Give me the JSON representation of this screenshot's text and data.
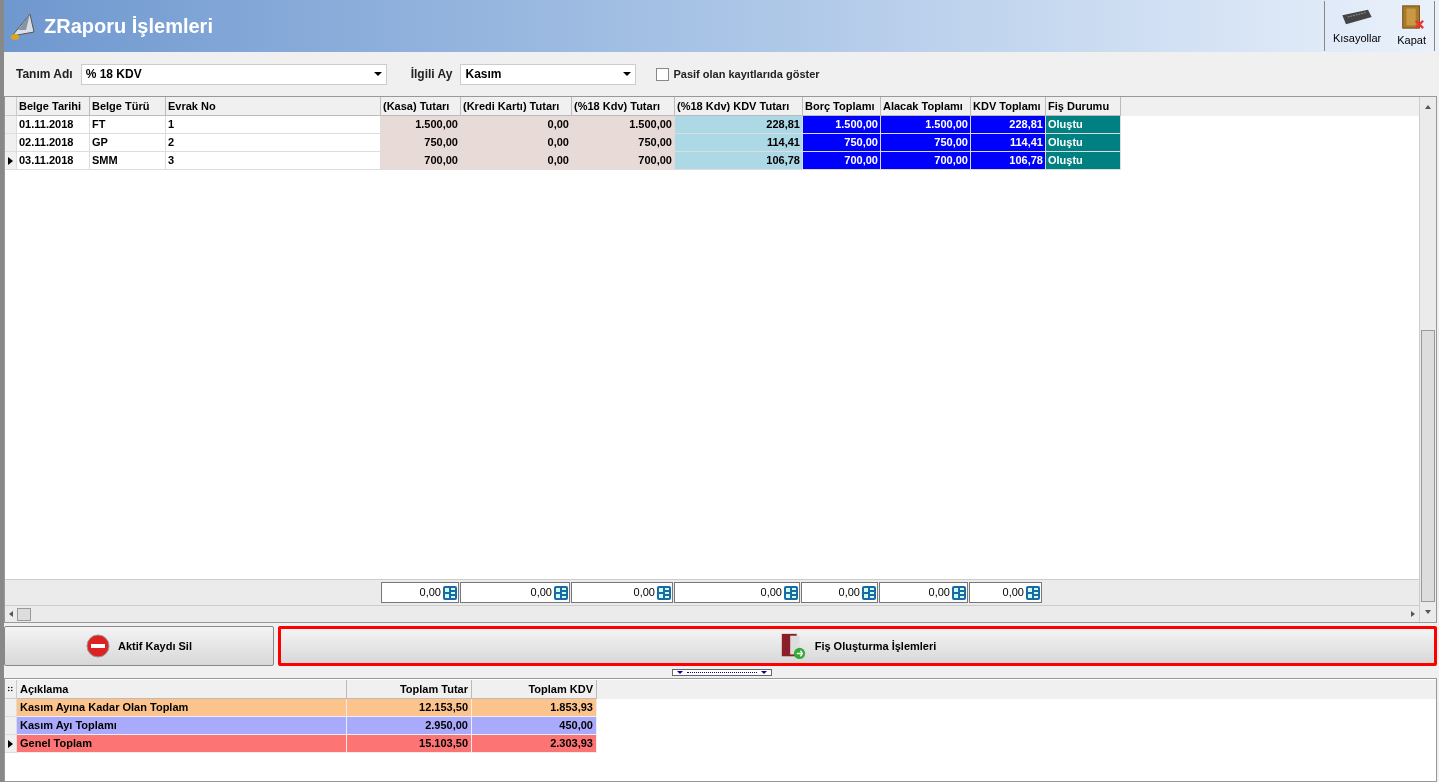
{
  "window": {
    "title": "ZRaporu İşlemleri"
  },
  "toolbar": [
    {
      "label": "Kısayollar",
      "kind": "keyboard"
    },
    {
      "label": "Kapat",
      "kind": "close"
    }
  ],
  "filters": {
    "tanim_label": "Tanım Adı",
    "tanim_value": "% 18 KDV",
    "ay_label": "İlgili Ay",
    "ay_value": "Kasım",
    "pasif": {
      "label": "Pasif olan kayıtlarıda göster",
      "checked": false
    }
  },
  "table": {
    "columns": [
      {
        "label": "Belge Tarihi",
        "color": "#ffffff"
      },
      {
        "label": "Belge Türü",
        "color": "#ffffff"
      },
      {
        "label": "Evrak No",
        "color": "#ffffff"
      },
      {
        "label": "(Kasa) Tutarı",
        "color": "#e8dad6"
      },
      {
        "label": "(Kredi Kartı) Tutarı",
        "color": "#e8dad6"
      },
      {
        "label": "(%18 Kdv) Tutarı",
        "color": "#e8dad6"
      },
      {
        "label": "(%18 Kdv) KDV Tutarı",
        "color": "#add8e6"
      },
      {
        "label": "Borç Toplamı",
        "color": "#0000ff"
      },
      {
        "label": "Alacak Toplamı",
        "color": "#0000ff"
      },
      {
        "label": "KDV Toplamı",
        "color": "#0000ff"
      },
      {
        "label": "Fiş Durumu",
        "color": "#008080"
      }
    ],
    "rows": [
      {
        "selected": false,
        "cells": [
          "01.11.2018",
          "FT",
          "1",
          "1.500,00",
          "0,00",
          "1.500,00",
          "228,81",
          "1.500,00",
          "1.500,00",
          "228,81",
          "Oluştu"
        ]
      },
      {
        "selected": false,
        "cells": [
          "02.11.2018",
          "GP",
          "2",
          "750,00",
          "0,00",
          "750,00",
          "114,41",
          "750,00",
          "750,00",
          "114,41",
          "Oluştu"
        ]
      },
      {
        "selected": true,
        "cells": [
          "03.11.2018",
          "SMM",
          "3",
          "700,00",
          "0,00",
          "700,00",
          "106,78",
          "700,00",
          "700,00",
          "106,78",
          "Oluştu"
        ]
      }
    ],
    "footer_totals": [
      "0,00",
      "0,00",
      "0,00",
      "0,00",
      "0,00",
      "0,00",
      "0,00"
    ]
  },
  "buttons": [
    {
      "label": "Aktif Kaydı Sil",
      "kind": "delete",
      "focused": false
    },
    {
      "label": "Fiş Oluşturma İşlemleri",
      "kind": "voucher",
      "focused": true
    }
  ],
  "summary": {
    "columns": [
      "Açıklama",
      "Toplam Tutar",
      "Toplam KDV"
    ],
    "rows": [
      {
        "selected": false,
        "color": "#fcc48c",
        "cells": [
          "Kasım Ayına Kadar Olan Toplam",
          "12.153,50",
          "1.853,93"
        ]
      },
      {
        "selected": false,
        "color": "#aaaafc",
        "cells": [
          "Kasım Ayı Toplamı",
          "2.950,00",
          "450,00"
        ]
      },
      {
        "selected": true,
        "color": "#fc7474",
        "cells": [
          "Genel Toplam",
          "15.103,50",
          "2.303,93"
        ]
      }
    ]
  }
}
